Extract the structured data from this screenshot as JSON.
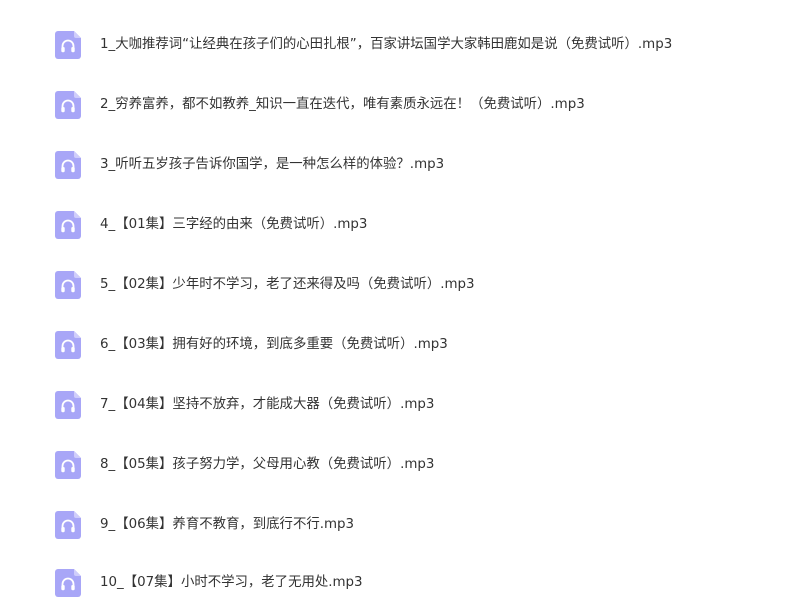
{
  "files": [
    {
      "name": "1_大咖推荐词“让经典在孩子们的心田扎根”，百家讲坛国学大家韩田鹿如是说（免费试听）.mp3",
      "icon": "audio-file-icon"
    },
    {
      "name": "2_穷养富养，都不如教养_知识一直在迭代，唯有素质永远在！（免费试听）.mp3",
      "icon": "audio-file-icon"
    },
    {
      "name": "3_听听五岁孩子告诉你国学，是一种怎么样的体验？.mp3",
      "icon": "audio-file-icon"
    },
    {
      "name": "4_【01集】三字经的由来（免费试听）.mp3",
      "icon": "audio-file-icon"
    },
    {
      "name": "5_【02集】少年时不学习，老了还来得及吗（免费试听）.mp3",
      "icon": "audio-file-icon"
    },
    {
      "name": "6_【03集】拥有好的环境，到底多重要（免费试听）.mp3",
      "icon": "audio-file-icon"
    },
    {
      "name": "7_【04集】坚持不放弃，才能成大器（免费试听）.mp3",
      "icon": "audio-file-icon"
    },
    {
      "name": "8_【05集】孩子努力学，父母用心教（免费试听）.mp3",
      "icon": "audio-file-icon"
    },
    {
      "name": "9_【06集】养育不教育，到底行不行.mp3",
      "icon": "audio-file-icon"
    },
    {
      "name": "10_【07集】小时不学习，老了无用处.mp3",
      "icon": "audio-file-icon"
    }
  ],
  "colors": {
    "icon_body": "#a8a6f7",
    "icon_fold": "#cfcdfb",
    "text": "#333333"
  }
}
